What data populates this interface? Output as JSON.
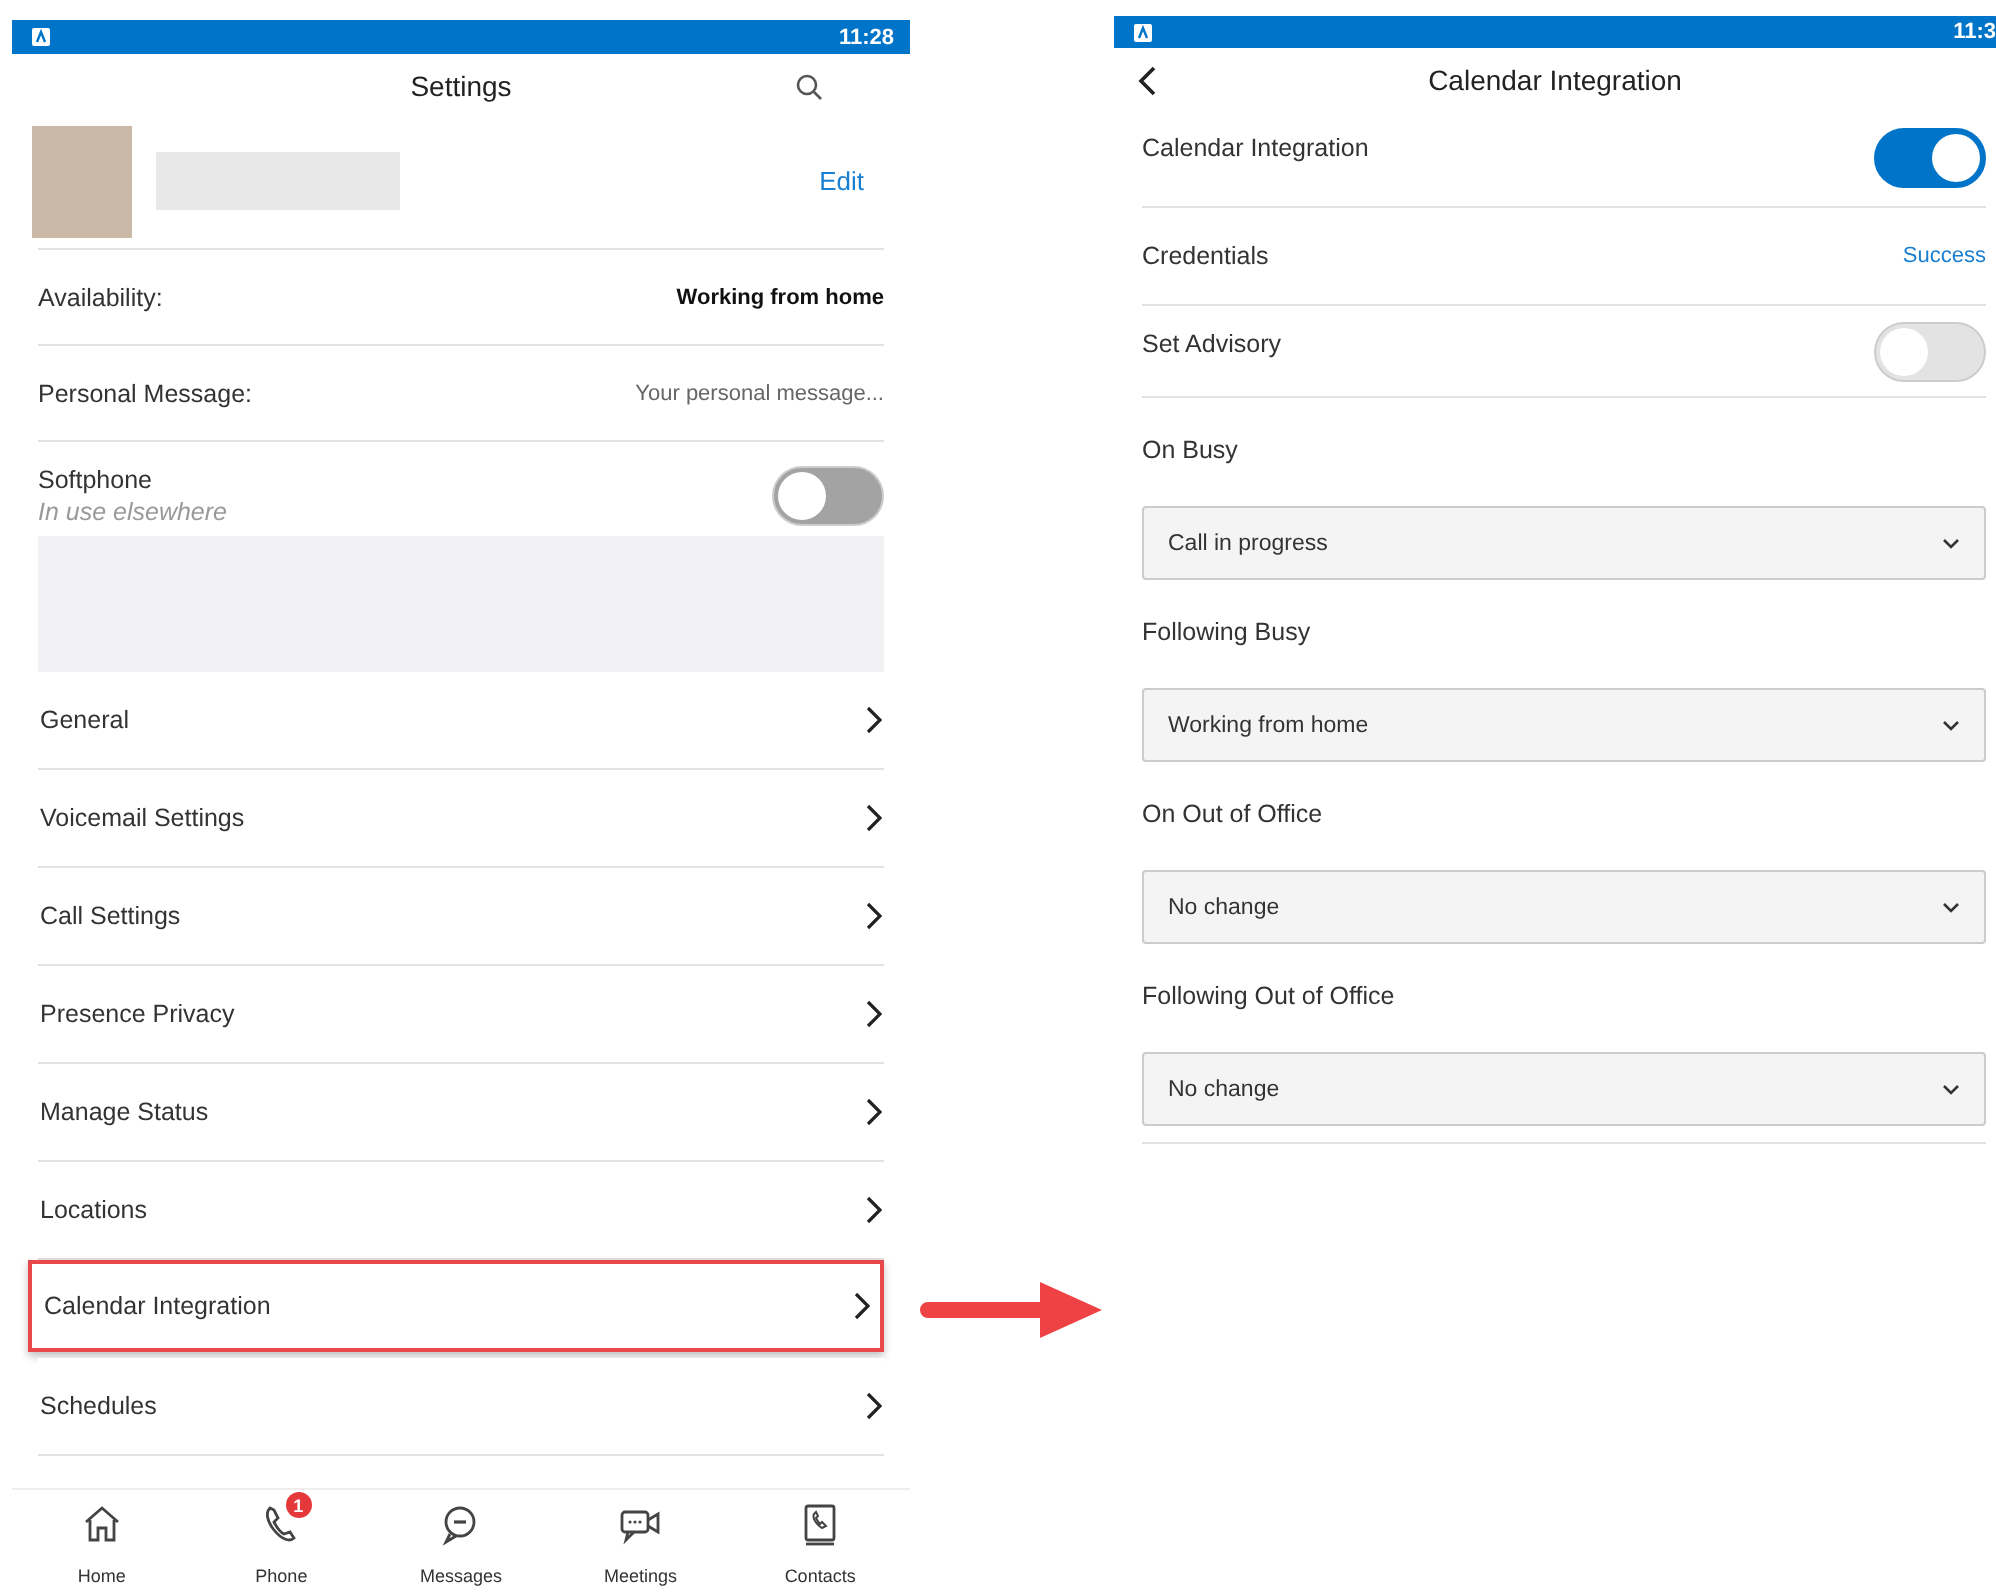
{
  "settings_screen": {
    "status_bar": {
      "time": "11:28"
    },
    "title": "Settings",
    "profile": {
      "edit_link": "Edit"
    },
    "rows": [
      {
        "kind": "value",
        "label": "Availability:",
        "value": "Working from home",
        "bold": true
      },
      {
        "kind": "value",
        "label": "Personal Message:",
        "value": "Your personal message...",
        "bold": false
      },
      {
        "kind": "toggle",
        "label": "Softphone",
        "subtitle": "In use elsewhere",
        "on": false
      }
    ],
    "menu_items": [
      {
        "label": "General",
        "selected": false
      },
      {
        "label": "Voicemail Settings",
        "selected": false
      },
      {
        "label": "Call Settings",
        "selected": false
      },
      {
        "label": "Presence Privacy",
        "selected": false
      },
      {
        "label": "Manage Status",
        "selected": false
      },
      {
        "label": "Locations",
        "selected": false
      },
      {
        "label": "Calendar Integration",
        "selected": true
      },
      {
        "label": "Schedules",
        "selected": false
      }
    ],
    "bottom_nav": [
      {
        "label": "Home"
      },
      {
        "label": "Phone",
        "badge": "1"
      },
      {
        "label": "Messages"
      },
      {
        "label": "Meetings"
      },
      {
        "label": "Contacts"
      }
    ]
  },
  "calendar_screen": {
    "status_bar": {
      "time": "11:3"
    },
    "title": "Calendar Integration",
    "rows": [
      {
        "kind": "toggle",
        "label": "Calendar Integration",
        "on": true
      },
      {
        "kind": "status",
        "label": "Credentials",
        "value": "Success"
      },
      {
        "kind": "toggle",
        "label": "Set Advisory",
        "on": false
      }
    ],
    "selects": [
      {
        "label": "On Busy",
        "value": "Call in progress"
      },
      {
        "label": "Following Busy",
        "value": "Working from home"
      },
      {
        "label": "On Out of Office",
        "value": "No change"
      },
      {
        "label": "Following Out of Office",
        "value": "No change"
      }
    ]
  }
}
